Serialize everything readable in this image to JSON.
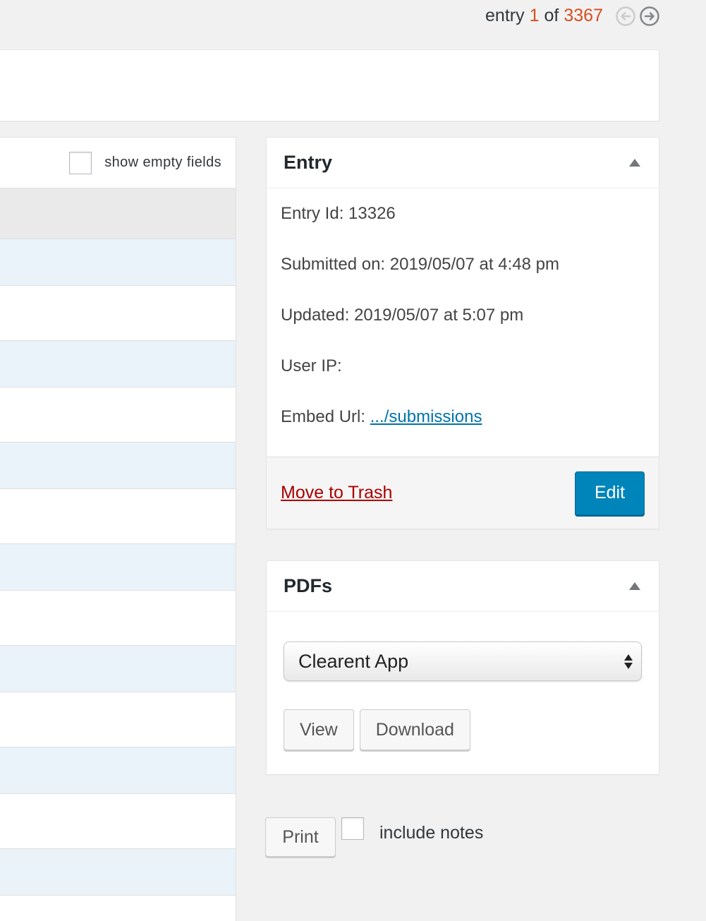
{
  "pager": {
    "prefix": "entry",
    "current": "1",
    "of": "of",
    "total": "3367",
    "prev_icon": "arrow-left-circle-icon",
    "next_icon": "arrow-right-circle-icon"
  },
  "detail": {
    "show_empty_label": "show empty fields"
  },
  "entry_box": {
    "title": "Entry",
    "entry_id": "Entry Id: 13326",
    "submitted": "Submitted on: 2019/05/07 at 4:48 pm",
    "updated": "Updated: 2019/05/07 at 5:07 pm",
    "user_ip": "User IP:",
    "embed_label": "Embed Url:",
    "embed_link": ".../submissions",
    "trash_label": "Move to Trash",
    "edit_label": "Edit"
  },
  "pdf_box": {
    "title": "PDFs",
    "selected": "Clearent App",
    "view_label": "View",
    "download_label": "Download"
  },
  "print": {
    "button_label": "Print",
    "notes_label": "include notes"
  },
  "colors": {
    "accent": "#0085ba",
    "highlight": "#d54e21",
    "danger": "#a00",
    "link": "#0073aa"
  }
}
